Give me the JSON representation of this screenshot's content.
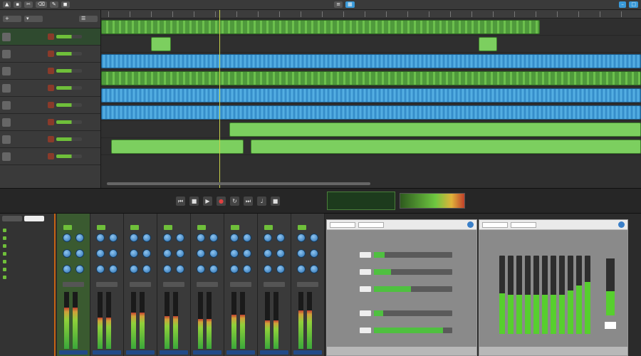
{
  "app": {
    "accent": "#3a9ad9",
    "clip_green": "#6cc04d",
    "clip_blue": "#2f86c4"
  },
  "toolbar": {
    "buttons": [
      "tool-pointer",
      "tool-range",
      "tool-split",
      "tool-erase",
      "tool-draw",
      "tool-mute"
    ],
    "right_buttons": [
      "window-min",
      "window-max"
    ]
  },
  "tracks": [
    {
      "icon": "drum-icon",
      "color": "green",
      "selected": true
    },
    {
      "icon": "drum-icon",
      "color": "green",
      "selected": false
    },
    {
      "icon": "guitar-icon",
      "color": "blue",
      "selected": false
    },
    {
      "icon": "bass-icon",
      "color": "green",
      "selected": false
    },
    {
      "icon": "vocal-icon",
      "color": "blue",
      "selected": false
    },
    {
      "icon": "vocal-icon",
      "color": "blue",
      "selected": false
    },
    {
      "icon": "keys-icon",
      "color": "green",
      "selected": false
    },
    {
      "icon": "synth-icon",
      "color": "green",
      "selected": false
    }
  ],
  "transport": {
    "buttons": [
      "rewind",
      "stop",
      "play",
      "record",
      "loop",
      "forward",
      "metronome",
      "punch"
    ]
  },
  "browser": {
    "tabs": [
      "loops",
      "instruments",
      "effects"
    ],
    "items": [
      "",
      "",
      "",
      "",
      "",
      "",
      ""
    ]
  },
  "mixer": {
    "channels": [
      {
        "level": 0.72,
        "selected": true
      },
      {
        "level": 0.55,
        "selected": false
      },
      {
        "level": 0.64,
        "selected": false
      },
      {
        "level": 0.58,
        "selected": false
      },
      {
        "level": 0.52,
        "selected": false
      },
      {
        "level": 0.6,
        "selected": false
      },
      {
        "level": 0.5,
        "selected": false
      },
      {
        "level": 0.68,
        "selected": false
      }
    ]
  },
  "compressor": {
    "params": [
      {
        "level": 0.14
      },
      {
        "level": 0.22
      },
      {
        "level": 0.47
      },
      {
        "level": 0.12
      },
      {
        "level": 0.88
      }
    ]
  },
  "equalizer": {
    "bands": [
      0.52,
      0.5,
      0.5,
      0.5,
      0.5,
      0.5,
      0.5,
      0.5,
      0.55,
      0.62,
      0.66
    ],
    "output": 0.42
  }
}
